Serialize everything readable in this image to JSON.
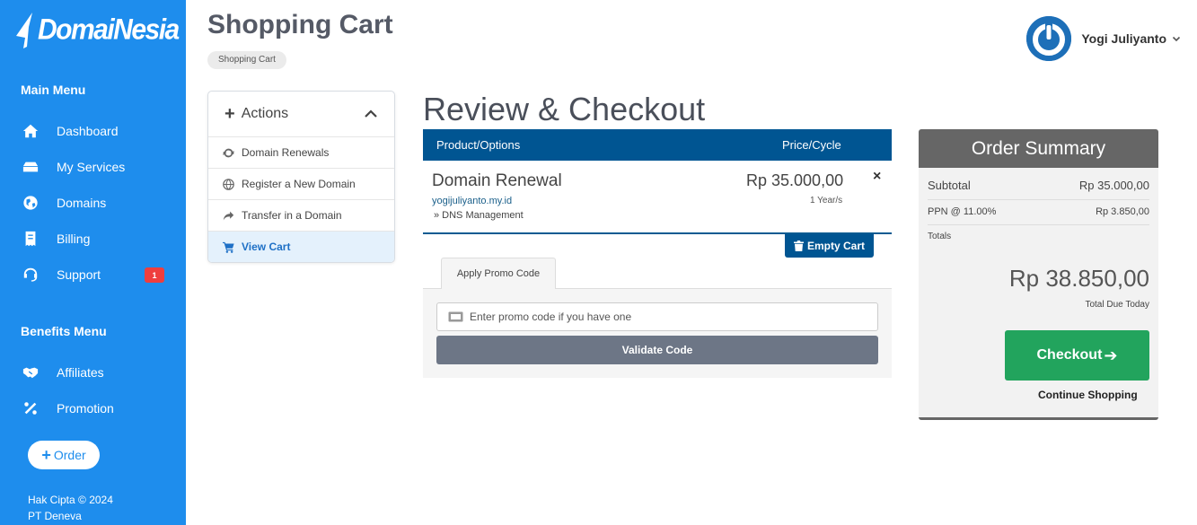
{
  "brand": {
    "logo_text": "DomaiNesia"
  },
  "sidebar": {
    "main_menu_title": "Main Menu",
    "main_items": [
      {
        "label": "Dashboard",
        "icon": "home-icon"
      },
      {
        "label": "My Services",
        "icon": "server-icon"
      },
      {
        "label": "Domains",
        "icon": "globe-icon"
      },
      {
        "label": "Billing",
        "icon": "receipt-icon"
      },
      {
        "label": "Support",
        "icon": "headset-icon",
        "badge": "1"
      }
    ],
    "benefits_menu_title": "Benefits Menu",
    "benefits_items": [
      {
        "label": "Affiliates",
        "icon": "handshake-icon"
      },
      {
        "label": "Promotion",
        "icon": "percent-icon"
      }
    ],
    "order_button": "Order",
    "copyright_line1": "Hak Cipta © 2024",
    "copyright_line2": "PT Deneva"
  },
  "header": {
    "title": "Shopping Cart",
    "breadcrumb": "Shopping Cart",
    "user_name": "Yogi Juliyanto"
  },
  "actions_panel": {
    "title": "Actions",
    "items": [
      {
        "label": "Domain Renewals",
        "icon": "refresh-icon"
      },
      {
        "label": "Register a New Domain",
        "icon": "globe-icon"
      },
      {
        "label": "Transfer in a Domain",
        "icon": "share-arrow-icon"
      },
      {
        "label": "View Cart",
        "icon": "cart-icon",
        "active": true
      }
    ]
  },
  "review": {
    "title": "Review & Checkout",
    "col_product": "Product/Options",
    "col_price": "Price/Cycle",
    "item": {
      "name": "Domain Renewal",
      "domain": "yogijuliyanto.my.id",
      "addon": "» DNS Management",
      "price": "Rp 35.000,00",
      "cycle": "1 Year/s",
      "remove": "×"
    },
    "empty_cart": "Empty Cart",
    "promo_tab": "Apply Promo Code",
    "promo_placeholder": "Enter promo code if you have one",
    "validate_button": "Validate Code"
  },
  "summary": {
    "title": "Order Summary",
    "subtotal_label": "Subtotal",
    "subtotal_value": "Rp 35.000,00",
    "tax_label": "PPN @ 11.00%",
    "tax_value": "Rp 3.850,00",
    "totals_label": "Totals",
    "total_value": "Rp 38.850,00",
    "total_due_label": "Total Due Today",
    "checkout_button": "Checkout",
    "continue_link": "Continue Shopping"
  },
  "colors": {
    "sidebar_bg": "#1e8ded",
    "header_blue": "#005592",
    "checkout_green": "#22a45d",
    "summary_gray": "#666666",
    "badge_red": "#ef3e3e"
  }
}
